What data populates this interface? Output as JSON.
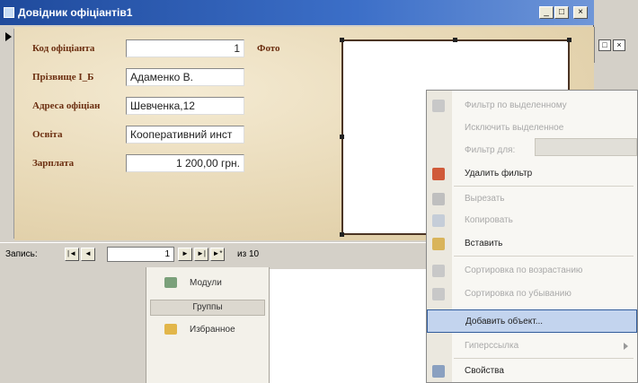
{
  "window": {
    "title": "Довідник офіціантів1",
    "controls": [
      "_",
      "□",
      "×"
    ]
  },
  "background_window": {
    "controls": [
      "□",
      "×"
    ]
  },
  "form": {
    "fields": [
      {
        "label": "Код офіціанта",
        "value": "1"
      },
      {
        "label": "Прізвище І_Б",
        "value": "Адаменко В."
      },
      {
        "label": "Адреса офіціан",
        "value": "Шевченка,12"
      },
      {
        "label": "Освіта",
        "value": "Кооперативний инст"
      },
      {
        "label": "Зарплата",
        "value": "1 200,00 грн."
      }
    ],
    "photo_label": "Фото"
  },
  "record_nav": {
    "label": "Запись:",
    "current": "1",
    "total_text": "из 10",
    "buttons": [
      "|◄",
      "◄",
      "►",
      "►|",
      "►*"
    ]
  },
  "db_window": {
    "items": [
      {
        "label": "Модули",
        "icon": "module-icon"
      },
      {
        "label": "Избранное",
        "icon": "folder-icon"
      }
    ],
    "groups_label": "Группы"
  },
  "context_menu": {
    "items": [
      {
        "label": "Фильтр по выделенному",
        "enabled": false,
        "icon": "filter-icon"
      },
      {
        "label": "Исключить выделенное",
        "enabled": false,
        "icon": ""
      },
      {
        "label": "Фильтр для:",
        "enabled": false,
        "icon": ""
      },
      {
        "label": "Удалить фильтр",
        "enabled": true,
        "icon": "remove-filter-icon"
      },
      {
        "label": "Вырезать",
        "enabled": false,
        "icon": "cut-icon"
      },
      {
        "label": "Копировать",
        "enabled": false,
        "icon": "copy-icon"
      },
      {
        "label": "Вставить",
        "enabled": true,
        "icon": "paste-icon"
      },
      {
        "label": "Сортировка по возрастанию",
        "enabled": false,
        "icon": "sort-asc-icon"
      },
      {
        "label": "Сортировка по убыванию",
        "enabled": false,
        "icon": "sort-desc-icon"
      },
      {
        "label": "Добавить объект...",
        "enabled": true,
        "icon": "",
        "highlighted": true
      },
      {
        "label": "Гиперссылка",
        "enabled": false,
        "icon": "",
        "submenu": true
      },
      {
        "label": "Свойства",
        "enabled": true,
        "icon": "properties-icon"
      }
    ]
  },
  "colors": {
    "title_bar": "#1f4a9c",
    "label_text": "#6b2e10",
    "highlight": "#c3d4ee"
  }
}
